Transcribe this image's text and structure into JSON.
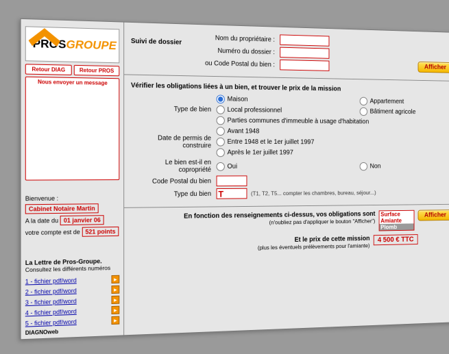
{
  "sidebar": {
    "logo_pros": "PROS",
    "logo_groupe": "GROUPE",
    "btn_diag": "Retour DIAG",
    "btn_pros": "Retour PROS",
    "btn_msg": "Nous envoyer un message",
    "welcome_label": "Bienvenue :",
    "welcome_value": "Cabinet Notaire Martin",
    "date_label": "A la date du",
    "date_value": "01 janvier 06",
    "points_label": "votre compte est de",
    "points_value": "521 points",
    "letter_title": "La Lettre de Pros-Groupe.",
    "letter_sub": "Consultez les différents numéros",
    "downloads": [
      "1 - fichier pdf/word",
      "2 - fichier pdf/word",
      "3 - fichier pdf/word",
      "4 - fichier pdf/word",
      "5 - fichier pdf/word"
    ],
    "footer": "DIAGNOweb"
  },
  "section1": {
    "title": "Suivi de dossier",
    "owner_label": "Nom du propriétaire :",
    "file_label": "Numéro du dossier :",
    "cp_label": "ou Code Postal du bien :",
    "btn": "Afficher"
  },
  "section2": {
    "title": "Vérifier les obligations liées à un bien, et trouver le prix de la mission",
    "type_label": "Type de bien",
    "type_opts": {
      "maison": "Maison",
      "appart": "Appartement",
      "local": "Local professionnel",
      "agri": "Bâtiment agricole",
      "parties": "Parties communes d'immeuble à usage d'habitation"
    },
    "permit_label": "Date de permis de construire",
    "permit_opts": {
      "a": "Avant 1948",
      "b": "Entre 1948 et le 1er juillet 1997",
      "c": "Après le 1er juillet 1997"
    },
    "copro_label": "Le bien est-il en copropriété",
    "copro_yes": "Oui",
    "copro_no": "Non",
    "cp_label": "Code Postal du bien",
    "tb_label": "Type du bien",
    "tb_value": "T",
    "tb_hint": "(T1, T2, T5... compter les chambres, bureau, séjour...)"
  },
  "section3": {
    "oblig_title": "En fonction des renseignements ci-dessus, vos obligations sont",
    "oblig_sub": "(n'oubliez pas d'appliquer le bouton \"Afficher\")",
    "items": {
      "a": "Surface",
      "b": "Amiante",
      "c": "Plomb"
    },
    "btn": "Afficher",
    "price_title": "Et le prix de cette mission",
    "price_sub": "(plus les éventuels prélèvements pour l'amiante)",
    "price_value": "4 500 € TTC"
  }
}
